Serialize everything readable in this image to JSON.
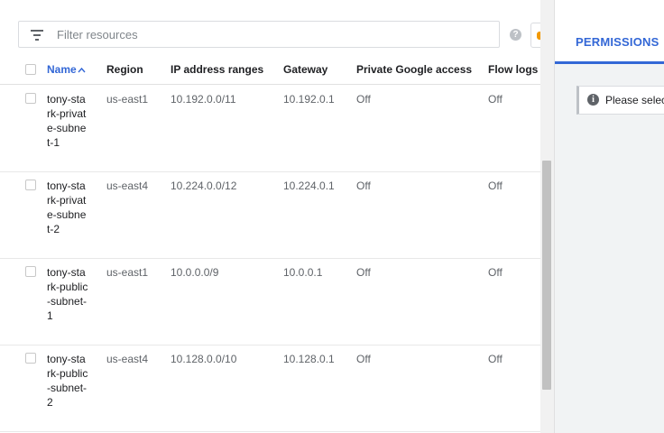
{
  "filter": {
    "placeholder": "Filter resources",
    "help_icon": "help-icon",
    "filter_icon": "filter-list-icon"
  },
  "table": {
    "headers": {
      "name": "Name",
      "region": "Region",
      "ip_ranges": "IP address ranges",
      "gateway": "Gateway",
      "private_google_access": "Private Google access",
      "flow_logs": "Flow logs"
    },
    "sort": {
      "column": "name",
      "direction": "ascending",
      "icon": "arrow-up-icon"
    },
    "rows": [
      {
        "name": "tony-stark-private-subnet-1",
        "region": "us-east1",
        "ip_ranges": "10.192.0.0/11",
        "gateway": "10.192.0.1",
        "private_google_access": "Off",
        "flow_logs": "Off"
      },
      {
        "name": "tony-stark-private-subnet-2",
        "region": "us-east4",
        "ip_ranges": "10.224.0.0/12",
        "gateway": "10.224.0.1",
        "private_google_access": "Off",
        "flow_logs": "Off"
      },
      {
        "name": "tony-stark-public-subnet-1",
        "region": "us-east1",
        "ip_ranges": "10.0.0.0/9",
        "gateway": "10.0.0.1",
        "private_google_access": "Off",
        "flow_logs": "Off"
      },
      {
        "name": "tony-stark-public-subnet-2",
        "region": "us-east4",
        "ip_ranges": "10.128.0.0/10",
        "gateway": "10.128.0.1",
        "private_google_access": "Off",
        "flow_logs": "Off"
      }
    ]
  },
  "side_panel": {
    "tab_label": "PERMISSIONS",
    "info_text": "Please select",
    "info_icon": "info-icon"
  },
  "colors": {
    "accent": "#3367d6",
    "panel_background": "#f1f3f4"
  }
}
